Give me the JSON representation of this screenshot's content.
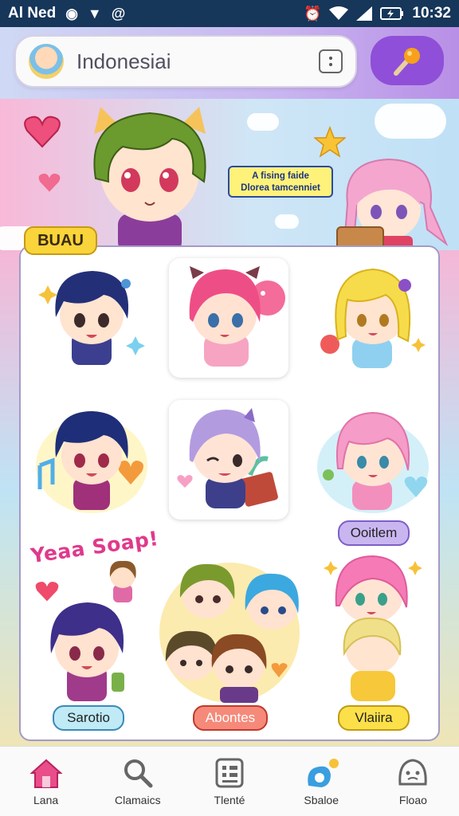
{
  "status_bar": {
    "left_text": "Al Ned",
    "time": "10:32"
  },
  "search": {
    "value": "Indonesiai"
  },
  "banner": {
    "speech_line1": "A fising faide",
    "speech_line2": "Dlorea tamcenniet"
  },
  "panel": {
    "tag": "BUAU",
    "sticker_text": "Yeaa Soap!",
    "chips": {
      "left": "Sarotio",
      "center": "Abontes",
      "right": "Vlaiira",
      "top_right": "Ooitlem"
    }
  },
  "nav": {
    "items": [
      {
        "label": "Lana",
        "icon": "home-icon"
      },
      {
        "label": "Clamaics",
        "icon": "search-icon"
      },
      {
        "label": "Tlenté",
        "icon": "list-icon"
      },
      {
        "label": "Sbaloe",
        "icon": "sticker-icon"
      },
      {
        "label": "Floao",
        "icon": "face-icon"
      }
    ]
  },
  "colors": {
    "accent_purple": "#8f4fd8",
    "home_pink": "#e94d8a",
    "status_bar": "#16365a"
  }
}
